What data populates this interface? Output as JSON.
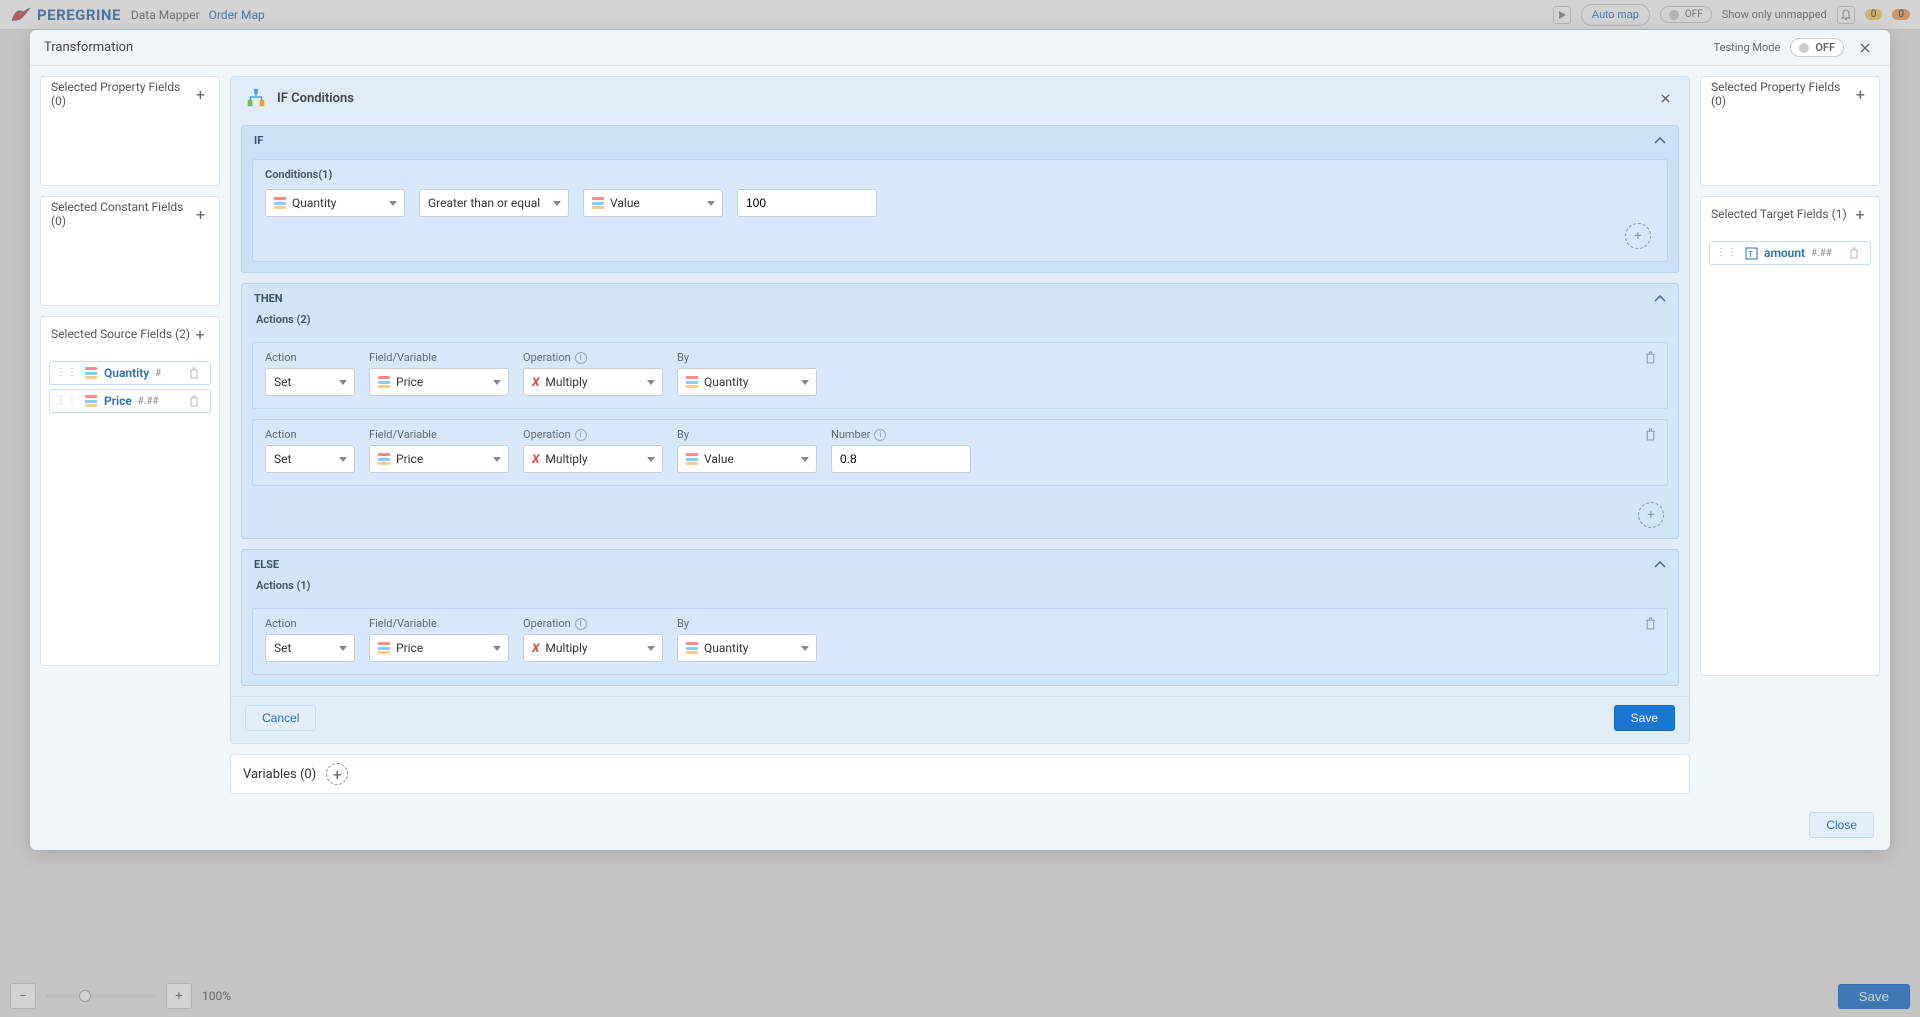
{
  "header": {
    "brand": "PEREGRINE",
    "crumb1": "Data Mapper",
    "crumb2": "Order Map",
    "auto_map": "Auto map",
    "toggle_off": "OFF",
    "show_unmapped": "Show only unmapped",
    "badge_warn": "0",
    "badge_err": "0"
  },
  "modal": {
    "title": "Transformation",
    "testing_mode_label": "Testing Mode",
    "testing_mode_state": "OFF",
    "close_label": "Close"
  },
  "left": {
    "prop_title": "Selected Property Fields (0)",
    "const_title": "Selected Constant Fields (0)",
    "src_title": "Selected Source Fields (2)",
    "src_fields": [
      {
        "name": "Quantity",
        "type": "#"
      },
      {
        "name": "Price",
        "type": "#.##"
      }
    ]
  },
  "right": {
    "prop_title": "Selected Property Fields (0)",
    "target_title": "Selected Target Fields (1)",
    "target_fields": [
      {
        "name": "amount",
        "type": "#.##"
      }
    ]
  },
  "cond": {
    "section_title": "IF Conditions",
    "if_label": "IF",
    "then_label": "THEN",
    "else_label": "ELSE",
    "conditions_label": "Conditions(1)",
    "actions_then_label": "Actions (2)",
    "actions_else_label": "Actions (1)",
    "labels": {
      "action": "Action",
      "field_var": "Field/Variable",
      "operation": "Operation",
      "by": "By",
      "number": "Number"
    },
    "if_row": {
      "field": "Quantity",
      "operator": "Greater than or equal",
      "comparand_type": "Value",
      "value": "100"
    },
    "then_rows": [
      {
        "action": "Set",
        "field": "Price",
        "operation": "Multiply",
        "by": "Quantity"
      },
      {
        "action": "Set",
        "field": "Price",
        "operation": "Multiply",
        "by": "Value",
        "number": "0.8"
      }
    ],
    "else_rows": [
      {
        "action": "Set",
        "field": "Price",
        "operation": "Multiply",
        "by": "Quantity"
      }
    ],
    "cancel": "Cancel",
    "save": "Save"
  },
  "variables": {
    "title": "Variables (0)"
  },
  "bottom": {
    "zoom": "100%",
    "save": "Save"
  }
}
